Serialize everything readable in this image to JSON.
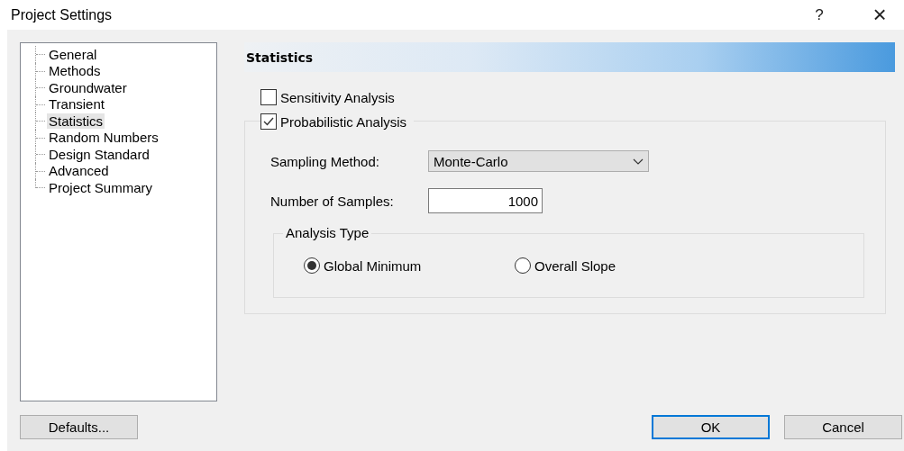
{
  "window": {
    "title": "Project Settings",
    "help": "?",
    "close": "×"
  },
  "sidebar": {
    "items": [
      {
        "label": "General",
        "selected": false
      },
      {
        "label": "Methods",
        "selected": false
      },
      {
        "label": "Groundwater",
        "selected": false
      },
      {
        "label": "Transient",
        "selected": false
      },
      {
        "label": "Statistics",
        "selected": true
      },
      {
        "label": "Random Numbers",
        "selected": false
      },
      {
        "label": "Design Standard",
        "selected": false
      },
      {
        "label": "Advanced",
        "selected": false
      },
      {
        "label": "Project Summary",
        "selected": false
      }
    ]
  },
  "panel": {
    "title": "Statistics",
    "sensitivity": {
      "label": "Sensitivity Analysis",
      "checked": false
    },
    "probabilistic": {
      "label": "Probabilistic Analysis",
      "checked": true
    },
    "sampling_method": {
      "label": "Sampling Method:",
      "value": "Monte-Carlo"
    },
    "number_of_samples": {
      "label": "Number of Samples:",
      "value": "1000"
    },
    "analysis_type": {
      "title": "Analysis Type",
      "options": [
        {
          "label": "Global Minimum",
          "selected": true
        },
        {
          "label": "Overall Slope",
          "selected": false
        }
      ]
    }
  },
  "buttons": [
    {
      "label": "Defaults...",
      "kind": "plain"
    },
    {
      "label": "OK",
      "kind": "default"
    },
    {
      "label": "Cancel",
      "kind": "plain"
    }
  ]
}
